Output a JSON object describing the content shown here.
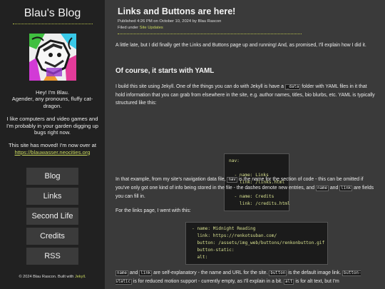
{
  "sidebar": {
    "blog_title": "Blau's Blog",
    "bio": [
      "Hey! I'm Blau.",
      "Agender, any pronouns, fluffy cat-dragon.",
      "I like computers and video games and I'm probably in your garden digging up bugs right now.",
      "This site has moved! I'm now over at",
      "https://blauwasser.neocities.org"
    ],
    "nav": [
      "Blog",
      "Links",
      "Second Life",
      "Credits",
      "RSS"
    ],
    "footer_prefix": "© 2024 Blau Rascon. Built with ",
    "footer_link": "Jekyll",
    "footer_suffix": "."
  },
  "post": {
    "title": "Links and Buttons are here!",
    "published": "Published 4:26 PM on October 10, 2024 by Blau Rascon",
    "filed_prefix": "Filed under ",
    "category": "Site Updates",
    "intro": "A little late, but I did finally get the Links and Buttons page up and running! And, as promised, I'll explain how I did it.",
    "heading": "Of course, it starts with YAML",
    "jekyll_1": "I build this site using Jekyll. One of the things you can do with Jekyll is have a ",
    "jekyll_code": "_data",
    "jekyll_2": " folder with YAML files in it that hold information that you can grab from elsewhere in the site, e.g. author names, titles, bio blurbs, etc. YAML is typically structured like this:",
    "code_block_1": "nav:\n\n  - name: Links\n    link: /links.html\n\n  - name: Credits\n    link: /credits.html",
    "example_1": "In that example, from my site's navigation data file, ",
    "example_code_nav": "nav",
    "example_2": " is the name for the section of code - this can be omitted if you've only got one kind of info being stored in the file - the dashes denote new entries, and ",
    "example_code_name": "name",
    "example_3": " and ",
    "example_code_link": "link",
    "example_4": " are fields you can fill in.",
    "links_intro": "For the links page, I went with this:",
    "code_block_2": "- name: Midnight Reading\n  link: https://renkotsuban.com/\n  button: /assets/img_web/buttons/renkonbutton.gif\n  button-static:\n  alt:",
    "exp_code_name": "name",
    "exp_1": " and ",
    "exp_code_link": "link",
    "exp_2": " are self-explanatory - the name and URL for the site. ",
    "exp_code_button": "button",
    "exp_3": " is the default image link. ",
    "exp_code_static": "button-static",
    "exp_4": " is for reduced motion support - currently empty, as I'll explain in a bit. ",
    "exp_code_alt": "alt",
    "exp_5": " is for alt text, but I'm"
  },
  "colors": {
    "accent": "#c9d85e",
    "sidebar_bg": "#212121",
    "main_bg": "#3a3a3a"
  }
}
